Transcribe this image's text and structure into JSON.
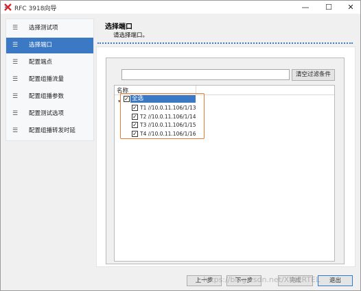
{
  "window": {
    "title": "RFC 3918向导",
    "controls": {
      "minimize": "—",
      "maximize": "☐",
      "close": "✕"
    }
  },
  "sidebar": {
    "items": [
      {
        "label": "选择测试项",
        "icon": "list-icon"
      },
      {
        "label": "选择端口",
        "icon": "list-icon",
        "active": true
      },
      {
        "label": "配置端点",
        "icon": "list-icon"
      },
      {
        "label": "配置组播流量",
        "icon": "list-icon"
      },
      {
        "label": "配置组播参数",
        "icon": "list-icon"
      },
      {
        "label": "配置测试选项",
        "icon": "list-icon"
      },
      {
        "label": "配置组播转发时延",
        "icon": "list-icon"
      }
    ]
  },
  "header": {
    "title": "选择端口",
    "subtitle": "请选择端口。"
  },
  "filter": {
    "value": "",
    "clear_label": "清空过滤条件"
  },
  "tree": {
    "column": "名称",
    "root": {
      "label": "全选",
      "checked": true
    },
    "children": [
      {
        "label": "T1 //10.0.11.106/1/13",
        "checked": true
      },
      {
        "label": "T2 //10.0.11.106/1/14",
        "checked": true
      },
      {
        "label": "T3 //10.0.11.106/1/15",
        "checked": true
      },
      {
        "label": "T4 //10.0.11.106/1/16",
        "checked": true
      }
    ]
  },
  "buttons": {
    "prev": "上一步",
    "next": "下一步",
    "finish": "完成",
    "exit": "退出"
  },
  "watermark": "https://blog.csdn.net/XINERTEL",
  "colors": {
    "accent": "#3c79c4",
    "highlight": "#e87a2a"
  }
}
